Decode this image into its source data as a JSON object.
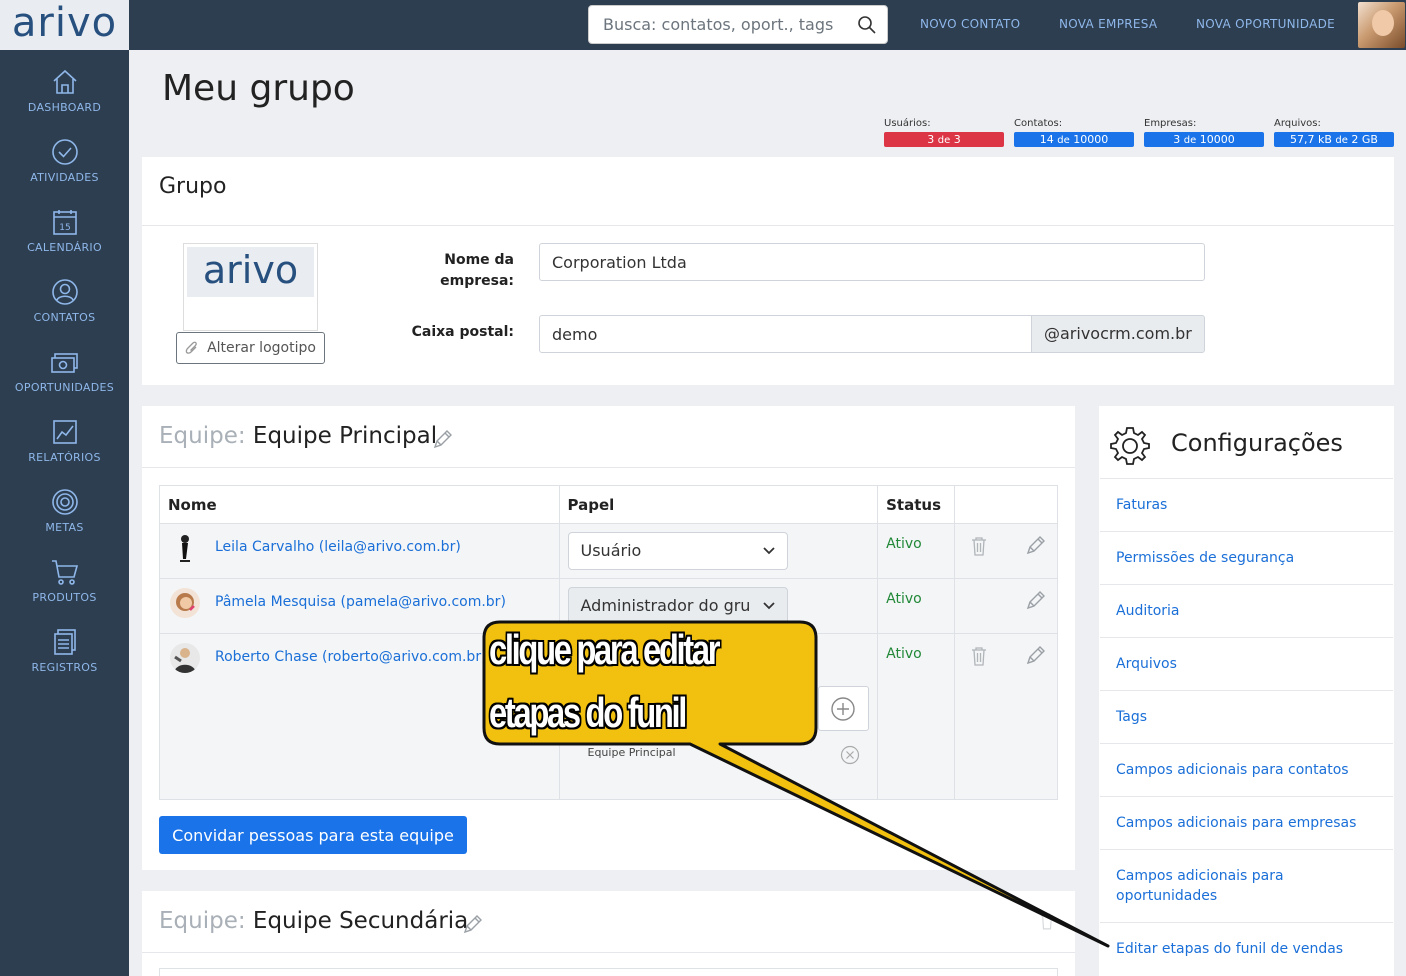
{
  "brand": {
    "logo_text": "arivo"
  },
  "sidebar": {
    "items": [
      {
        "label": "DASHBOARD",
        "icon": "home-icon"
      },
      {
        "label": "ATIVIDADES",
        "icon": "check-circle-icon"
      },
      {
        "label": "CALENDÁRIO",
        "icon": "calendar-icon",
        "day": "15"
      },
      {
        "label": "CONTATOS",
        "icon": "contact-icon"
      },
      {
        "label": "OPORTUNIDADES",
        "icon": "money-icon"
      },
      {
        "label": "RELATÓRIOS",
        "icon": "chart-icon"
      },
      {
        "label": "METAS",
        "icon": "target-icon"
      },
      {
        "label": "PRODUTOS",
        "icon": "cart-icon"
      },
      {
        "label": "REGISTROS",
        "icon": "records-icon"
      }
    ]
  },
  "topbar": {
    "search_placeholder": "Busca: contatos, oport., tags",
    "links": [
      "NOVO CONTATO",
      "NOVA EMPRESA",
      "NOVA OPORTUNIDADE"
    ]
  },
  "page": {
    "title": "Meu grupo"
  },
  "quotas": [
    {
      "label": "Usuários:",
      "value": "3",
      "sep": "de",
      "max": "3",
      "color": "#dc3545"
    },
    {
      "label": "Contatos:",
      "value": "14",
      "sep": "de",
      "max": "10000",
      "color": "#1a73e8"
    },
    {
      "label": "Empresas:",
      "value": "3",
      "sep": "de",
      "max": "10000",
      "color": "#1a73e8"
    },
    {
      "label": "Arquivos:",
      "value": "57,7 kB",
      "sep": "de",
      "max": "2 GB",
      "color": "#1a73e8"
    }
  ],
  "group": {
    "title": "Grupo",
    "logo_text": "arivo",
    "change_logo": "Alterar logotipo",
    "company_label_1": "Nome da",
    "company_label_2": "empresa:",
    "company_value": "Corporation Ltda",
    "mailbox_label": "Caixa postal:",
    "mailbox_value": "demo",
    "mailbox_domain": "@arivocrm.com.br"
  },
  "team1": {
    "prefix": "Equipe:",
    "name": "Equipe Principal",
    "columns": [
      "Nome",
      "Papel",
      "Status"
    ],
    "rows": [
      {
        "name": "Leila Carvalho (leila@arivo.com.br)",
        "role": "Usuário",
        "status": "Ativo"
      },
      {
        "name": "Pâmela Mesquisa (pamela@arivo.com.br)",
        "role": "Administrador do gru",
        "status": "Ativo"
      },
      {
        "name": "Roberto Chase (roberto@arivo.com.br)",
        "role": "",
        "status": "Ativo",
        "team_tag": "Equipe Principal"
      }
    ],
    "invite_button": "Convidar pessoas para esta equipe"
  },
  "team2": {
    "prefix": "Equipe:",
    "name": "Equipe Secundária"
  },
  "settings": {
    "title": "Configurações",
    "links": [
      "Faturas",
      "Permissões de segurança",
      "Auditoria",
      "Arquivos",
      "Tags",
      "Campos adicionais para contatos",
      "Campos adicionais para empresas",
      "Campos adicionais para oportunidades",
      "Editar etapas do funil de vendas"
    ],
    "link_multiline": [
      "Campos adicionais para",
      "oportunidades"
    ]
  },
  "callout": {
    "line1": "clique para editar",
    "line2": "etapas do funil",
    "color": "#f2c10f"
  }
}
